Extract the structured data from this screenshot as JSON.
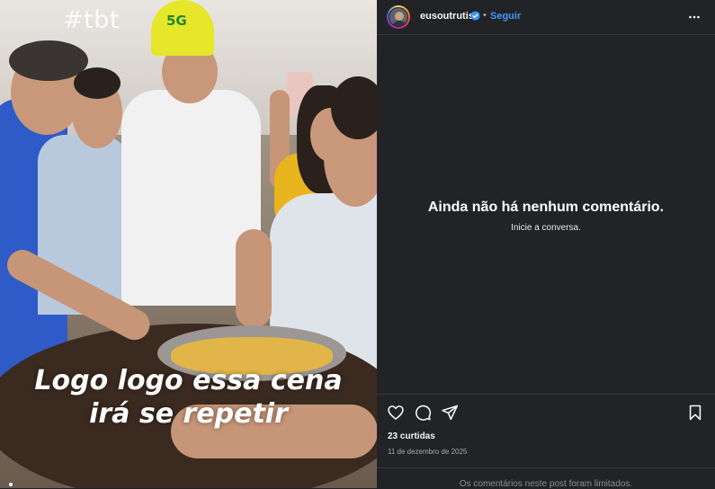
{
  "media": {
    "hashtag": "#tbt",
    "cap_text": "5G",
    "caption_line1": "Logo logo essa cena",
    "caption_line2": "irá se repetir"
  },
  "header": {
    "username": "eusoutrutis",
    "verified": true,
    "separator": "•",
    "follow_label": "Seguir",
    "more_icon": "more-horizontal-icon"
  },
  "comments": {
    "empty_title": "Ainda não há nenhum comentário.",
    "empty_subtitle": "Inicie a conversa."
  },
  "actions": {
    "icons": [
      "heart-icon",
      "comment-icon",
      "share-icon",
      "bookmark-icon"
    ]
  },
  "stats": {
    "likes": "23 curtidas",
    "date": "11 de dezembro de 2025"
  },
  "footer": {
    "limited_text": "Os comentários neste post foram limitados."
  },
  "colors": {
    "background": "#222327",
    "link": "#4a93ff",
    "secondary_text": "#a8a8a8"
  }
}
